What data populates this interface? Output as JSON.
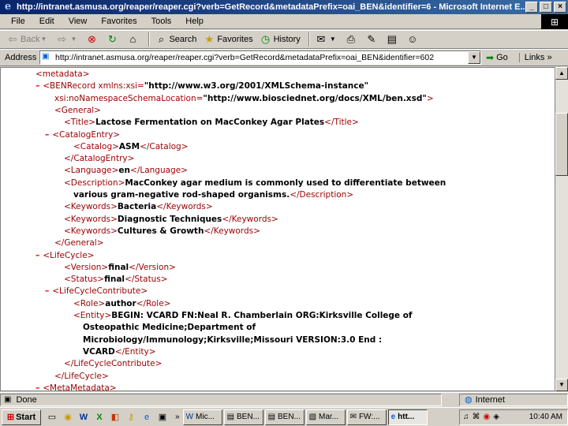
{
  "window": {
    "title": "http://intranet.asmusa.org/reaper/reaper.cgi?verb=GetRecord&metadataPrefix=oai_BEN&identifier=6 - Microsoft Internet E...",
    "controls": [
      "_",
      "□",
      "×"
    ]
  },
  "menu": [
    "File",
    "Edit",
    "View",
    "Favorites",
    "Tools",
    "Help"
  ],
  "toolbar": {
    "back": "Back",
    "forward": "",
    "search": "Search",
    "favorites": "Favorites",
    "history": "History"
  },
  "address": {
    "label": "Address",
    "value": "http://intranet.asmusa.org/reaper/reaper.cgi?verb=GetRecord&metadataPrefix=oai_BEN&identifier=602",
    "go": "Go",
    "links": "Links »"
  },
  "xml_lines": [
    {
      "indent": 0,
      "minus": "",
      "parts": [
        {
          "c": "tag",
          "t": "<metadata>"
        }
      ]
    },
    {
      "indent": 1,
      "minus": "–",
      "parts": [
        {
          "c": "tag",
          "t": "<BENRecord "
        },
        {
          "c": "atn",
          "t": "xmlns:xsi="
        },
        {
          "c": "atv",
          "t": "\"http://www.w3.org/2001/XMLSchema-instance\""
        }
      ]
    },
    {
      "indent": 2,
      "minus": "",
      "parts": [
        {
          "c": "atn",
          "t": "xsi:noNamespaceSchemaLocation="
        },
        {
          "c": "atv",
          "t": "\"http://www.biosciednet.org/docs/XML/ben.xsd\""
        },
        {
          "c": "tag",
          "t": ">"
        }
      ]
    },
    {
      "indent": 2,
      "minus": "",
      "parts": [
        {
          "c": "tag",
          "t": "<General>"
        }
      ]
    },
    {
      "indent": 3,
      "minus": "",
      "parts": [
        {
          "c": "tag",
          "t": "<Title>"
        },
        {
          "c": "val",
          "t": "Lactose Fermentation on MacConkey Agar Plates"
        },
        {
          "c": "tag",
          "t": "</Title>"
        }
      ]
    },
    {
      "indent": 2,
      "minus": "–",
      "parts": [
        {
          "c": "tag",
          "t": "<CatalogEntry>"
        }
      ]
    },
    {
      "indent": 4,
      "minus": "",
      "parts": [
        {
          "c": "tag",
          "t": "<Catalog>"
        },
        {
          "c": "val",
          "t": "ASM"
        },
        {
          "c": "tag",
          "t": "</Catalog>"
        }
      ]
    },
    {
      "indent": 3,
      "minus": "",
      "parts": [
        {
          "c": "tag",
          "t": "</CatalogEntry>"
        }
      ]
    },
    {
      "indent": 3,
      "minus": "",
      "parts": [
        {
          "c": "tag",
          "t": "<Language>"
        },
        {
          "c": "val",
          "t": "en"
        },
        {
          "c": "tag",
          "t": "</Language>"
        }
      ]
    },
    {
      "indent": 3,
      "minus": "",
      "parts": [
        {
          "c": "tag",
          "t": "<Description>"
        },
        {
          "c": "val",
          "t": "MacConkey agar medium is commonly used to differentiate between"
        }
      ]
    },
    {
      "indent": 4,
      "minus": "",
      "parts": [
        {
          "c": "val",
          "t": "various gram-negative rod-shaped organisms."
        },
        {
          "c": "tag",
          "t": "</Description>"
        }
      ]
    },
    {
      "indent": 3,
      "minus": "",
      "parts": [
        {
          "c": "tag",
          "t": "<Keywords>"
        },
        {
          "c": "val",
          "t": "Bacteria"
        },
        {
          "c": "tag",
          "t": "</Keywords>"
        }
      ]
    },
    {
      "indent": 3,
      "minus": "",
      "parts": [
        {
          "c": "tag",
          "t": "<Keywords>"
        },
        {
          "c": "val",
          "t": "Diagnostic Techniques"
        },
        {
          "c": "tag",
          "t": "</Keywords>"
        }
      ]
    },
    {
      "indent": 3,
      "minus": "",
      "parts": [
        {
          "c": "tag",
          "t": "<Keywords>"
        },
        {
          "c": "val",
          "t": "Cultures & Growth"
        },
        {
          "c": "tag",
          "t": "</Keywords>"
        }
      ]
    },
    {
      "indent": 2,
      "minus": "",
      "parts": [
        {
          "c": "tag",
          "t": "</General>"
        }
      ]
    },
    {
      "indent": 1,
      "minus": "–",
      "parts": [
        {
          "c": "tag",
          "t": "<LifeCycle>"
        }
      ]
    },
    {
      "indent": 3,
      "minus": "",
      "parts": [
        {
          "c": "tag",
          "t": "<Version>"
        },
        {
          "c": "val",
          "t": "final"
        },
        {
          "c": "tag",
          "t": "</Version>"
        }
      ]
    },
    {
      "indent": 3,
      "minus": "",
      "parts": [
        {
          "c": "tag",
          "t": "<Status>"
        },
        {
          "c": "val",
          "t": "final"
        },
        {
          "c": "tag",
          "t": "</Status>"
        }
      ]
    },
    {
      "indent": 2,
      "minus": "–",
      "parts": [
        {
          "c": "tag",
          "t": "<LifeCycleContribute>"
        }
      ]
    },
    {
      "indent": 4,
      "minus": "",
      "parts": [
        {
          "c": "tag",
          "t": "<Role>"
        },
        {
          "c": "val",
          "t": "author"
        },
        {
          "c": "tag",
          "t": "</Role>"
        }
      ]
    },
    {
      "indent": 4,
      "minus": "",
      "parts": [
        {
          "c": "tag",
          "t": "<Entity>"
        },
        {
          "c": "val",
          "t": "BEGIN: VCARD FN:Neal R. Chamberlain ORG:Kirksville College of"
        }
      ]
    },
    {
      "indent": 5,
      "minus": "",
      "parts": [
        {
          "c": "val",
          "t": "Osteopathic Medicine;Department of"
        }
      ]
    },
    {
      "indent": 5,
      "minus": "",
      "parts": [
        {
          "c": "val",
          "t": "Microbiology/Immunology;Kirksville;Missouri VERSION:3.0 End :"
        }
      ]
    },
    {
      "indent": 5,
      "minus": "",
      "parts": [
        {
          "c": "val",
          "t": "VCARD"
        },
        {
          "c": "tag",
          "t": "</Entity>"
        }
      ]
    },
    {
      "indent": 3,
      "minus": "",
      "parts": [
        {
          "c": "tag",
          "t": "</LifeCycleContribute>"
        }
      ]
    },
    {
      "indent": 2,
      "minus": "",
      "parts": [
        {
          "c": "tag",
          "t": "</LifeCycle>"
        }
      ]
    },
    {
      "indent": 1,
      "minus": "–",
      "parts": [
        {
          "c": "tag",
          "t": "<MetaMetadata>"
        }
      ]
    }
  ],
  "status": {
    "left": "Done",
    "zone": "Internet"
  },
  "taskbar": {
    "start": "Start",
    "chevron": "»",
    "tasks": [
      "Mic...",
      "BEN...",
      "BEN...",
      "Mar...",
      "FW:...",
      "htt..."
    ],
    "clock": "10:40 AM"
  }
}
